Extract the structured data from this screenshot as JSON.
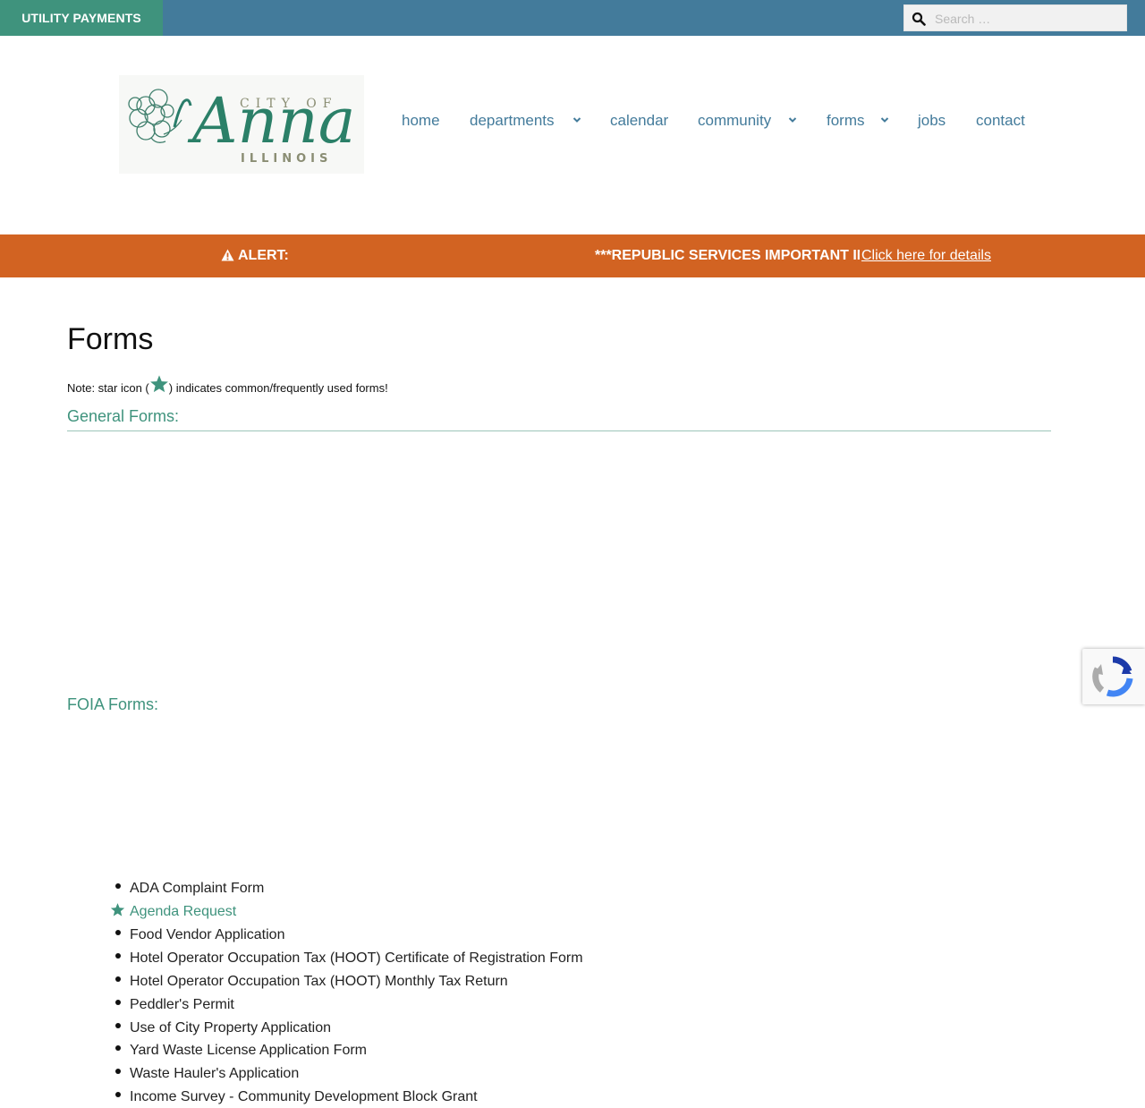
{
  "topbar": {
    "utility_payments_label": "UTILITY PAYMENTS",
    "search_placeholder": "Search …"
  },
  "logo": {
    "line1": "CITY OF",
    "line2": "Anna",
    "line3": "ILLINOIS"
  },
  "nav": {
    "items": [
      {
        "label": "home",
        "has_dropdown": false
      },
      {
        "label": "departments",
        "has_dropdown": true
      },
      {
        "label": "calendar",
        "has_dropdown": false
      },
      {
        "label": "community",
        "has_dropdown": true
      },
      {
        "label": "forms",
        "has_dropdown": true
      },
      {
        "label": "jobs",
        "has_dropdown": false
      },
      {
        "label": "contact",
        "has_dropdown": false
      }
    ]
  },
  "alert": {
    "label": "ALERT:",
    "ticker_text": "***REPUBLIC SERVICES IMPORTANT INFORMATION***",
    "link_text": "Click here for details"
  },
  "main": {
    "title": "Forms",
    "note_before": "Note: star icon (",
    "note_after": ") indicates common/frequently used forms!",
    "general_heading": "General Forms:",
    "general_forms": [
      {
        "label": "ADA Complaint Form",
        "starred": false
      },
      {
        "label": "Agenda Request",
        "starred": true
      },
      {
        "label": "Food Vendor Application",
        "starred": false
      },
      {
        "label": "Hotel Operator Occupation Tax (HOOT) Certificate of Registration Form",
        "starred": false
      },
      {
        "label": "Hotel Operator Occupation Tax (HOOT) Monthly Tax Return",
        "starred": false
      },
      {
        "label": "Peddler's Permit",
        "starred": false
      },
      {
        "label": "Use of City Property Application",
        "starred": false
      },
      {
        "label": "Yard Waste License Application Form",
        "starred": false
      },
      {
        "label": "Waste Hauler's Application",
        "starred": false
      },
      {
        "label": "Income Survey - Community Development Block Grant",
        "starred": false
      }
    ],
    "foia_heading": "FOIA Forms:"
  },
  "colors": {
    "topbar": "#437b9b",
    "utility_button": "#3f937d",
    "alert": "#d26322",
    "accent": "#3f937d",
    "nav_text": "#437b9b"
  },
  "icons": {
    "search": "search-icon",
    "alert": "warning-icon",
    "star": "star-icon",
    "dropdown": "chevron-down-icon",
    "captcha": "recaptcha-icon"
  }
}
